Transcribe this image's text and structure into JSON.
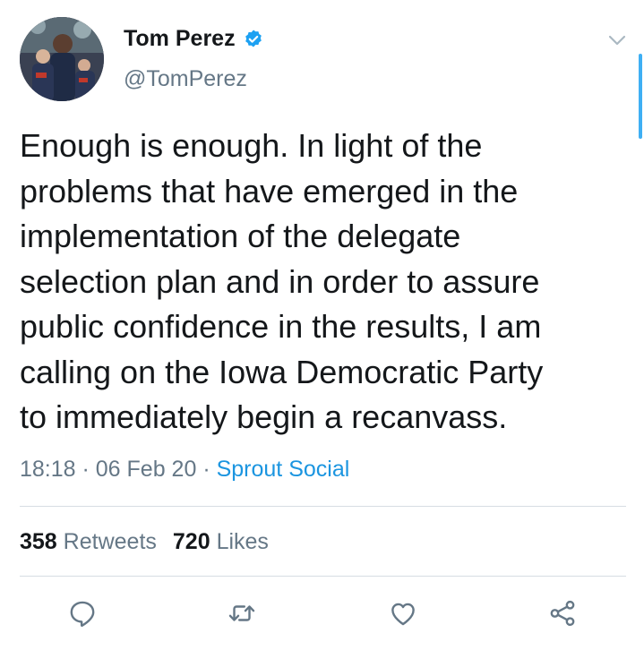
{
  "author": {
    "name": "Tom Perez",
    "handle": "@TomPerez",
    "verified": true
  },
  "tweet": {
    "lines": [
      "Enough is enough. In light of the",
      "problems that have emerged in the",
      "implementation of the delegate",
      "selection plan and in order to assure",
      "public confidence in the results, I am",
      "calling on the Iowa Democratic Party",
      "to immediately begin a recanvass."
    ],
    "time": "18:18",
    "date": "06 Feb 20",
    "separator": " · ",
    "source": "Sprout Social"
  },
  "stats": {
    "retweets_count": "358",
    "retweets_label": "Retweets",
    "likes_count": "720",
    "likes_label": "Likes"
  },
  "actions": [
    "reply-icon",
    "retweet-icon",
    "like-icon",
    "share-icon"
  ],
  "colors": {
    "text": "#14171a",
    "secondary": "#657786",
    "link": "#1b95e0",
    "verified": "#1da1f2",
    "divider": "#d6dde3"
  }
}
